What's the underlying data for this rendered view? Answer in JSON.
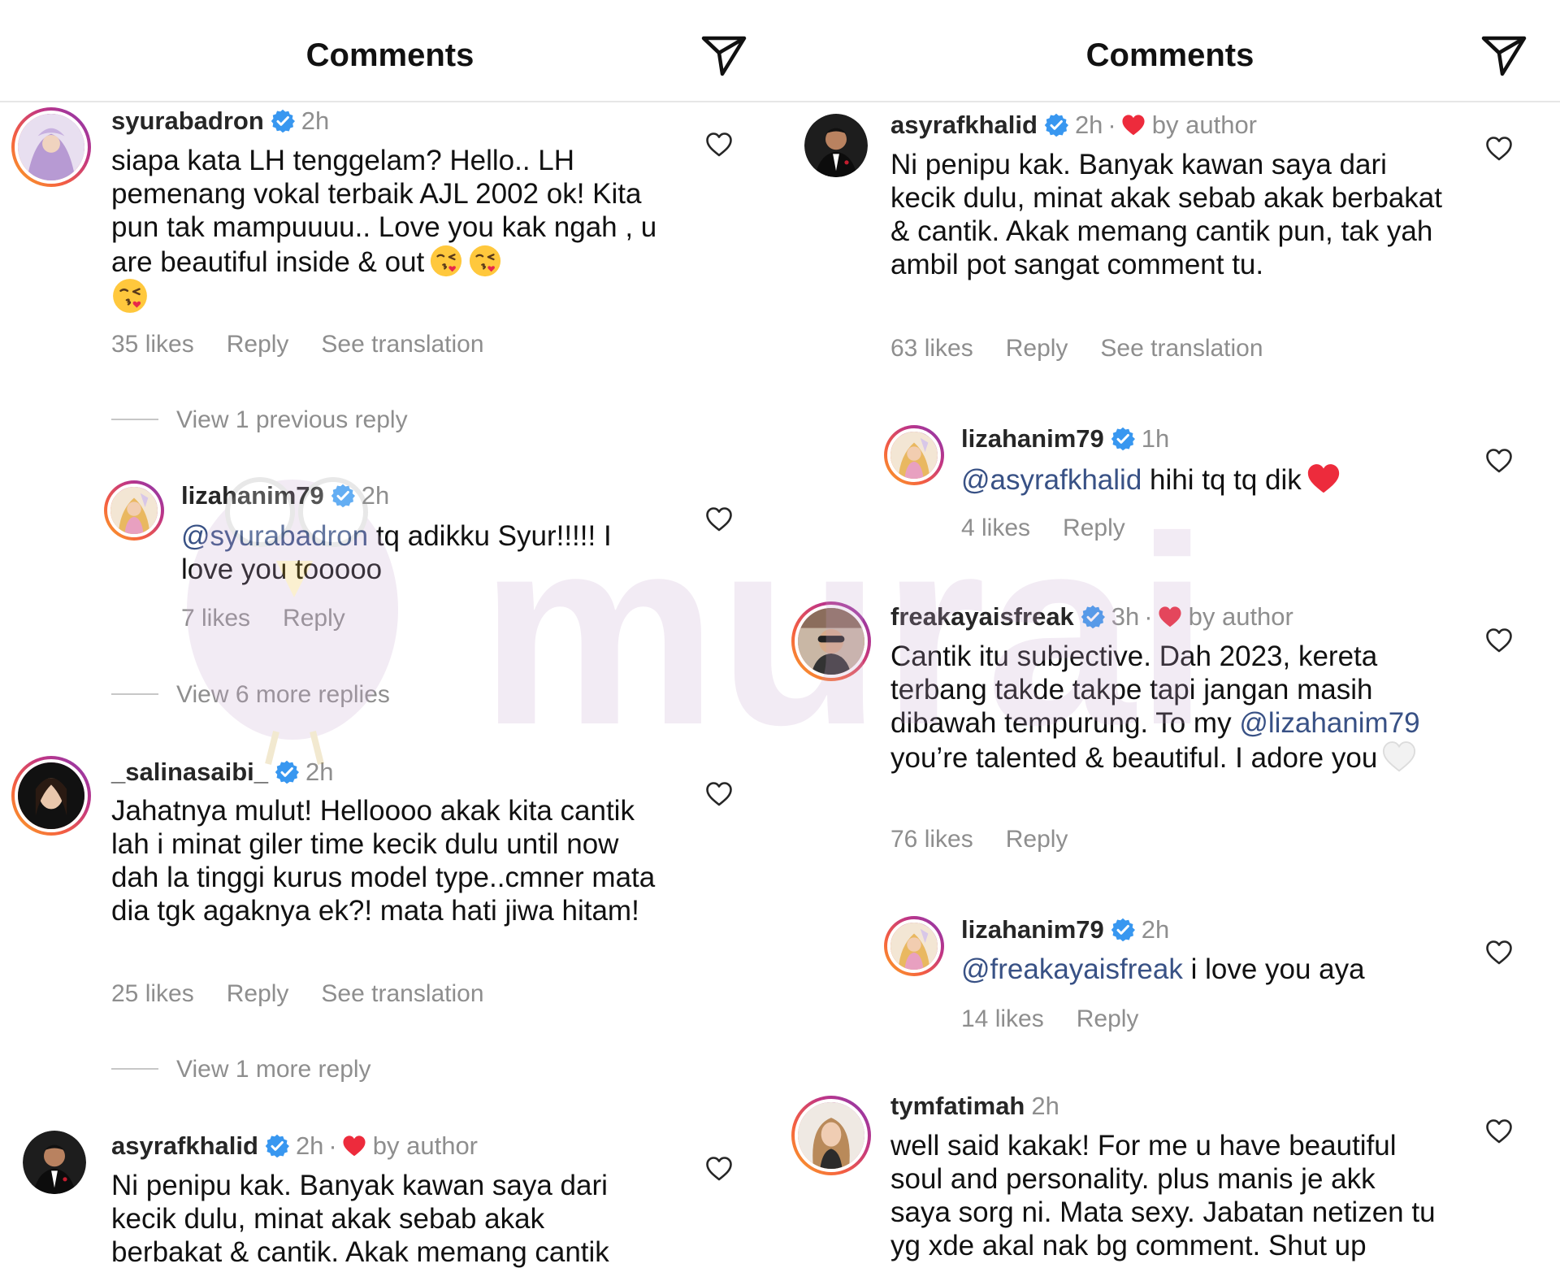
{
  "left": {
    "header": {
      "title": "Comments",
      "send_icon": "send-paper-plane-icon"
    },
    "c1": {
      "username": "syurabadron",
      "time": "2h",
      "text": "siapa kata LH tenggelam? Hello.. LH pemenang vokal terbaik AJL 2002 ok! Kita pun tak mampuuuu.. Love you kak ngah , u are beautiful inside & out",
      "emojis": [
        "face-blowing-kiss",
        "face-blowing-kiss",
        "face-blowing-kiss"
      ],
      "likes": "35 likes",
      "reply": "Reply",
      "translation": "See translation"
    },
    "view1": "View 1 previous reply",
    "r1": {
      "username": "lizahanim79",
      "time": "2h",
      "mention": "@syurabadron",
      "text": " tq adikku Syur!!!!! I love you tooooo",
      "likes": "7 likes",
      "reply": "Reply"
    },
    "view2": "View 6 more replies",
    "c2": {
      "username": "_salinasaibi_",
      "time": "2h",
      "text": "Jahatnya mulut! Helloooo akak kita cantik lah i minat giler time kecik dulu until now dah la tinggi kurus model type..cmner mata dia tgk agaknya ek?! mata hati jiwa hitam!",
      "likes": "25 likes",
      "reply": "Reply",
      "translation": "See translation"
    },
    "view3": "View 1 more reply",
    "c3": {
      "username": "asyrafkhalid",
      "time": "2h",
      "dot": "·",
      "byauthor": "by author",
      "text": "Ni penipu kak. Banyak kawan saya dari kecik dulu, minat akak sebab akak berbakat & cantik. Akak memang cantik"
    }
  },
  "right": {
    "header": {
      "title": "Comments",
      "send_icon": "send-paper-plane-icon"
    },
    "c1": {
      "username": "asyrafkhalid",
      "time": "2h",
      "dot": "·",
      "byauthor": "by author",
      "text": "Ni penipu kak. Banyak kawan saya dari kecik dulu, minat akak sebab akak berbakat & cantik. Akak memang cantik pun, tak yah ambil pot sangat comment tu.",
      "likes": "63 likes",
      "reply": "Reply",
      "translation": "See translation"
    },
    "r1": {
      "username": "lizahanim79",
      "time": "1h",
      "mention": "@asyrafkhalid",
      "text": " hihi tq tq dik",
      "emoji": "red-heart",
      "likes": "4 likes",
      "reply": "Reply"
    },
    "c2": {
      "username": "freakayaisfreak",
      "time": "3h",
      "dot": "·",
      "byauthor": "by author",
      "text_a": "Cantik itu subjective. Dah 2023, kereta terbang takde takpe tapi jangan masih dibawah tempurung. To my ",
      "mention": "@lizahanim79",
      "text_b": " you’re talented & beautiful. I adore you",
      "emoji": "white-heart",
      "likes": "76 likes",
      "reply": "Reply"
    },
    "r2": {
      "username": "lizahanim79",
      "time": "2h",
      "mention": "@freakayaisfreak",
      "text": " i love you aya",
      "likes": "14 likes",
      "reply": "Reply"
    },
    "c3": {
      "username": "tymfatimah",
      "time": "2h",
      "text": "well said kakak! For me u have beautiful soul and personality. plus manis je akk saya sorg ni. Mata sexy. Jabatan netizen tu yg xde akal nak bg comment. Shut up"
    }
  },
  "watermark": {
    "text": "murai"
  },
  "colors": {
    "verified": "#3897f0",
    "like_heart": "#ed2b3c",
    "mention": "#385185",
    "secondary_text": "#8e8e8e",
    "watermark": "#c9a6cf"
  }
}
